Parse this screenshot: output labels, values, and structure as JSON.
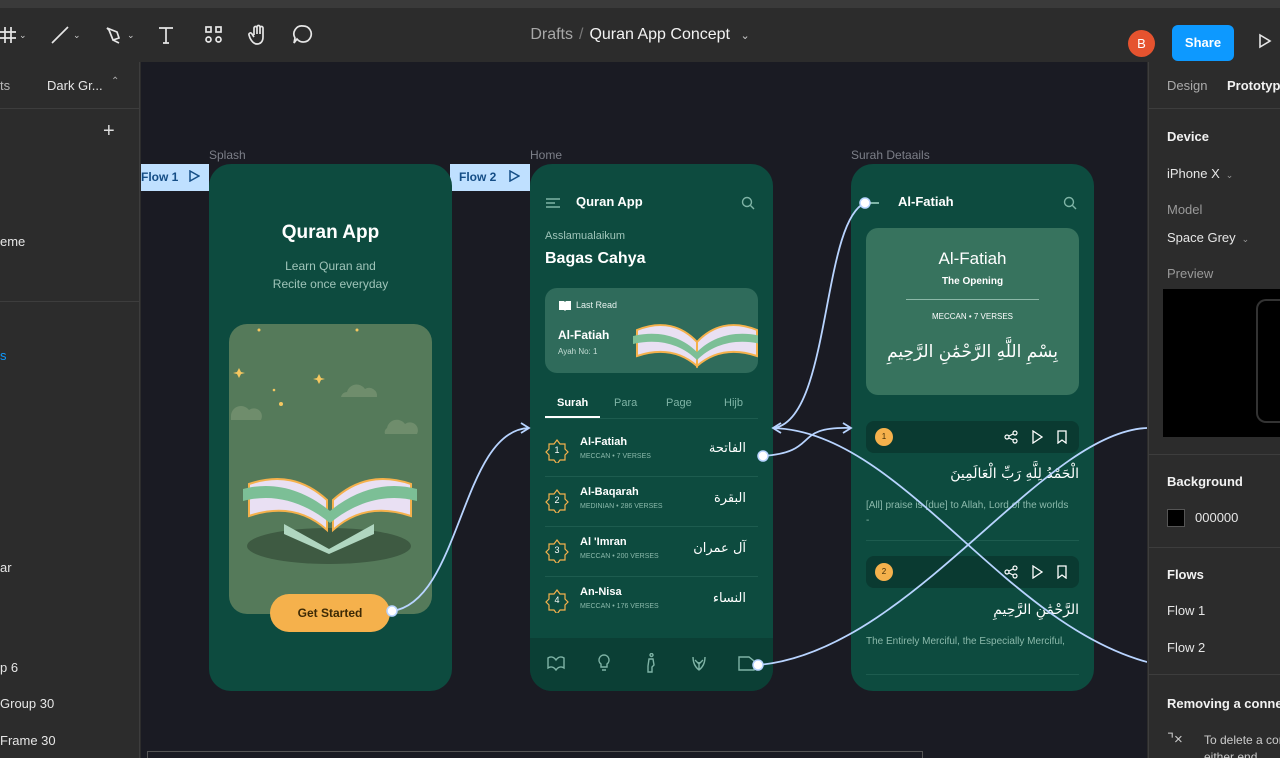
{
  "toolbar": {
    "breadcrumb_parent": "Drafts",
    "breadcrumb_sep": "/",
    "file_name": "Quran App Concept",
    "avatar_initial": "B",
    "share_label": "Share"
  },
  "left_panel": {
    "tab_partial": "ts",
    "page_name": "Dark Gr...",
    "item_theme": "eme",
    "item_bar": "ar",
    "item_group6": "p 6",
    "item_group30": "Group 30",
    "item_frame30": "Frame 30"
  },
  "canvas": {
    "frame_labels": [
      "Splash",
      "Home",
      "Surah Detaails"
    ],
    "flow_tags": [
      "Flow 1",
      "Flow 2"
    ]
  },
  "splash": {
    "title": "Quran App",
    "subtitle_line1": "Learn Quran and",
    "subtitle_line2": "Recite once everyday",
    "cta": "Get Started"
  },
  "home": {
    "app_title": "Quran App",
    "greeting": "Asslamualaikum",
    "user_name": "Bagas Cahya",
    "last_read_label": "Last Read",
    "last_read_surah": "Al-Fatiah",
    "last_read_ayah": "Ayah No: 1",
    "tabs": [
      "Surah",
      "Para",
      "Page",
      "Hijb"
    ],
    "surahs": [
      {
        "num": "1",
        "name": "Al-Fatiah",
        "meta": "MECCAN • 7 VERSES",
        "arabic": "الفاتحة"
      },
      {
        "num": "2",
        "name": "Al-Baqarah",
        "meta": "MEDINIAN • 286 VERSES",
        "arabic": "البقرة"
      },
      {
        "num": "3",
        "name": "Al 'Imran",
        "meta": "MECCAN • 200 VERSES",
        "arabic": "آل عمران"
      },
      {
        "num": "4",
        "name": "An-Nisa",
        "meta": "MECCAN • 176 VERSES",
        "arabic": "النساء"
      }
    ]
  },
  "detail": {
    "title": "Al-Fatiah",
    "card_title": "Al-Fatiah",
    "card_sub": "The Opening",
    "card_meta": "MECCAN • 7 VERSES",
    "bismillah": "بِسْمِ اللَّهِ الرَّحْمَٰنِ الرَّحِيمِ",
    "verses": [
      {
        "num": "1",
        "arabic": "الْحَمْدُ لِلَّهِ رَبِّ الْعَالَمِينَ",
        "translation": "[All] praise is [due] to Allah, Lord of the worlds -"
      },
      {
        "num": "2",
        "arabic": "الرَّحْمَٰنِ الرَّحِيمِ",
        "translation": "The Entirely Merciful, the Especially Merciful,"
      }
    ]
  },
  "right_panel": {
    "tab_design": "Design",
    "tab_prototype": "Prototype",
    "device_heading": "Device",
    "device_value": "iPhone X",
    "model_label": "Model",
    "model_value": "Space Grey",
    "preview_label": "Preview",
    "background_heading": "Background",
    "background_hex": "000000",
    "flows_heading": "Flows",
    "flows": [
      "Flow 1",
      "Flow 2"
    ],
    "removing_heading": "Removing a connection",
    "removing_text": "To delete a connection, drag on either end"
  },
  "colors": {
    "phone_bg": "#0d4b3f",
    "accent": "#f5b14c",
    "share": "#0d99ff",
    "flow_tag": "#bfe0ff"
  }
}
